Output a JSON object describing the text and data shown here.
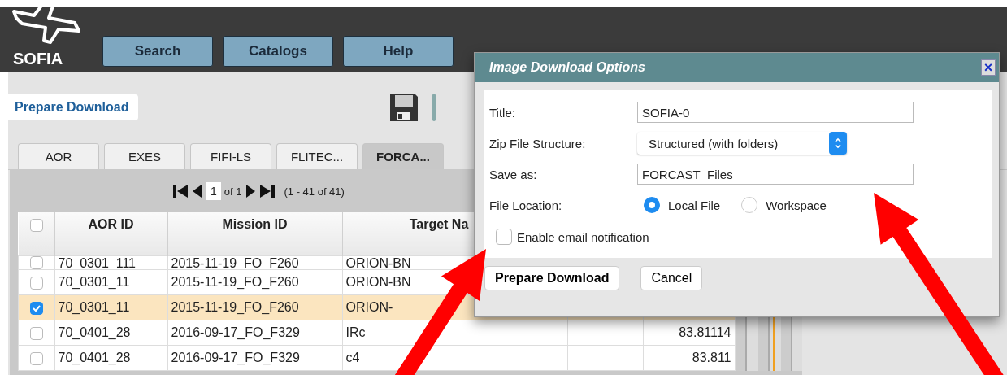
{
  "header": {
    "logo": "SOFIA",
    "nav": [
      {
        "label": "Search"
      },
      {
        "label": "Catalogs"
      },
      {
        "label": "Help"
      }
    ]
  },
  "toolbar": {
    "prepare_button": "Prepare Download"
  },
  "tabs": [
    {
      "label": "AOR",
      "selected": false
    },
    {
      "label": "EXES",
      "selected": false
    },
    {
      "label": "FIFI-LS",
      "selected": false
    },
    {
      "label": "FLITEC...",
      "selected": false
    },
    {
      "label": "FORCA...",
      "selected": true
    }
  ],
  "pager": {
    "page": "1",
    "of": "of 1",
    "range": "(1 - 41 of 41)"
  },
  "table": {
    "all_checked": false,
    "columns": [
      "AOR ID",
      "Mission ID",
      "Target Na"
    ],
    "rows": [
      {
        "checked": false,
        "cells": [
          "70_0301_111",
          "2015-11-19_FO_F260",
          "ORION-BN",
          ""
        ]
      },
      {
        "checked": false,
        "cells": [
          "70_0301_11",
          "2015-11-19_FO_F260",
          "ORION-BN",
          ""
        ]
      },
      {
        "checked": true,
        "cells": [
          "70_0301_11",
          "2015-11-19_FO_F260",
          "ORION-",
          ""
        ]
      },
      {
        "checked": false,
        "cells": [
          "70_0401_28",
          "2016-09-17_FO_F329",
          "IRc",
          "83.81114"
        ]
      },
      {
        "checked": false,
        "cells": [
          "70_0401_28",
          "2016-09-17_FO_F329",
          "c4",
          "83.811"
        ]
      }
    ]
  },
  "dialog": {
    "title": "Image Download Options",
    "close": "×",
    "fields": [
      {
        "kind": "text",
        "label": "Title:",
        "value": "SOFIA-0"
      },
      {
        "kind": "select",
        "label": "Zip File Structure:",
        "value": "Structured (with folders)"
      },
      {
        "kind": "text",
        "label": "Save as:",
        "value": "FORCAST_Files"
      },
      {
        "kind": "radio",
        "label": "File Location:",
        "options": [
          {
            "label": "Local File",
            "selected": true
          },
          {
            "label": "Workspace",
            "selected": false
          }
        ]
      }
    ],
    "email": {
      "label": "Enable email notification",
      "checked": false
    },
    "buttons": [
      {
        "label": "Prepare Download",
        "primary": true
      },
      {
        "label": "Cancel",
        "primary": false
      }
    ]
  }
}
